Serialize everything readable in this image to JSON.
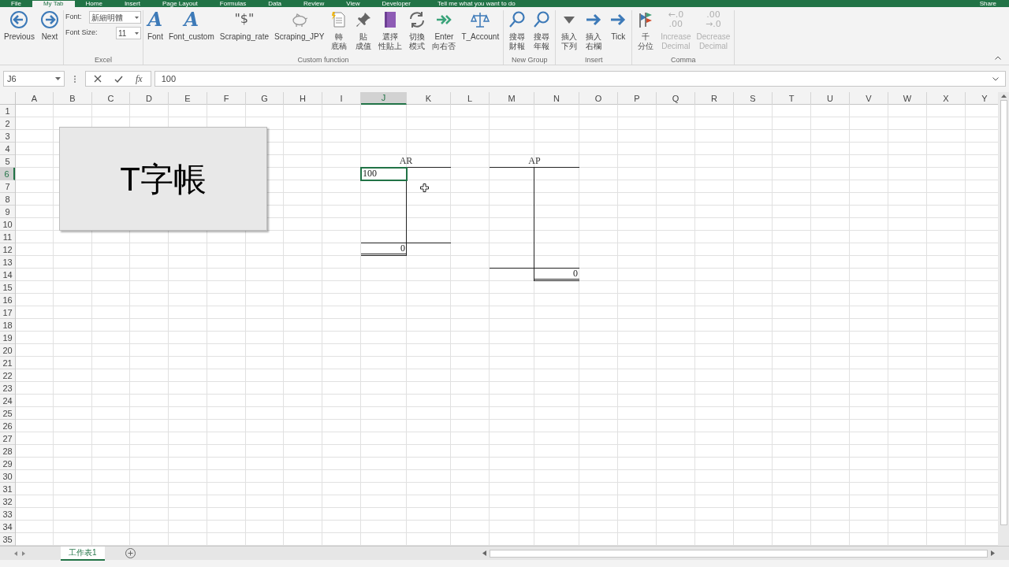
{
  "menu_tabs": [
    {
      "label": "File",
      "selected": false
    },
    {
      "label": "My Tab",
      "selected": true
    },
    {
      "label": "Home",
      "selected": false
    },
    {
      "label": "Insert",
      "selected": false
    },
    {
      "label": "Page Layout",
      "selected": false
    },
    {
      "label": "Formulas",
      "selected": false
    },
    {
      "label": "Data",
      "selected": false
    },
    {
      "label": "Review",
      "selected": false
    },
    {
      "label": "View",
      "selected": false
    },
    {
      "label": "Developer",
      "selected": false
    }
  ],
  "tell_me": "Tell me what you want to do",
  "share": "Share",
  "ribbon": {
    "groups": [
      {
        "items": [
          {
            "kind": "prev",
            "label": [
              "Previous"
            ],
            "disabled": false
          },
          {
            "kind": "next",
            "label": [
              "Next"
            ],
            "disabled": false
          }
        ]
      },
      {
        "label": "Excel",
        "fields": [
          {
            "label": "Font:",
            "value": "新細明體"
          },
          {
            "label": "Font Size:",
            "value": "11"
          }
        ]
      },
      {
        "label": "Custom function",
        "items": [
          {
            "kind": "letter",
            "icon_text": "A",
            "label": [
              "Font"
            ],
            "disabled": false
          },
          {
            "kind": "letter",
            "icon_text": "A",
            "label": [
              "Font_custom"
            ],
            "disabled": false
          },
          {
            "kind": "glyph",
            "icon_text": "\"$\"",
            "label": [
              "Scraping_rate"
            ],
            "disabled": false
          },
          {
            "kind": "piggy",
            "label": [
              "Scraping_JPY"
            ],
            "disabled": false
          },
          {
            "kind": "document",
            "label": [
              "轉",
              "底稿"
            ],
            "disabled": false
          },
          {
            "kind": "pin",
            "label": [
              "貼",
              "成值"
            ],
            "disabled": false
          },
          {
            "kind": "book",
            "label": [
              "選擇",
              "性貼上"
            ],
            "disabled": false
          },
          {
            "kind": "refresh",
            "label": [
              "切換",
              "模式"
            ],
            "disabled": false
          },
          {
            "kind": "double-arrow",
            "label": [
              "Enter",
              "向右否"
            ],
            "disabled": false
          },
          {
            "kind": "scale",
            "label": [
              "T_Account"
            ],
            "disabled": false
          }
        ]
      },
      {
        "label": "New Group",
        "items": [
          {
            "kind": "search",
            "label": [
              "搜尋",
              "財報"
            ],
            "disabled": false
          },
          {
            "kind": "search",
            "label": [
              "搜尋",
              "年報"
            ],
            "disabled": false
          }
        ]
      },
      {
        "label": "Insert",
        "items": [
          {
            "kind": "triangle",
            "label": [
              "插入",
              "下列"
            ],
            "disabled": false
          },
          {
            "kind": "arrow",
            "label": [
              "插入",
              "右欄"
            ],
            "disabled": false
          },
          {
            "kind": "arrow",
            "label": [
              "Tick"
            ],
            "disabled": false
          }
        ]
      },
      {
        "label": "Comma",
        "items": [
          {
            "kind": "flags",
            "label": [
              "千",
              "分位"
            ],
            "disabled": false
          },
          {
            "kind": "glyph",
            "icon_text": "←.0\n.00",
            "label": [
              "Increase",
              "Decimal"
            ],
            "disabled": true
          },
          {
            "kind": "glyph",
            "icon_text": ".00\n→.0",
            "label": [
              "Decrease",
              "Decimal"
            ],
            "disabled": true
          }
        ]
      }
    ]
  },
  "formula_bar": {
    "name_box": "J6",
    "fx": "fx",
    "formula": "100"
  },
  "columns": [
    {
      "label": "A",
      "selected": false
    },
    {
      "label": "B",
      "selected": false
    },
    {
      "label": "C",
      "selected": false
    },
    {
      "label": "D",
      "selected": false
    },
    {
      "label": "E",
      "selected": false
    },
    {
      "label": "F",
      "selected": false
    },
    {
      "label": "G",
      "selected": false
    },
    {
      "label": "H",
      "selected": false
    },
    {
      "label": "I",
      "selected": false
    },
    {
      "label": "J",
      "selected": true
    },
    {
      "label": "K",
      "selected": false
    },
    {
      "label": "L",
      "selected": false
    },
    {
      "label": "M",
      "selected": false
    },
    {
      "label": "N",
      "selected": false
    },
    {
      "label": "O",
      "selected": false
    },
    {
      "label": "P",
      "selected": false
    },
    {
      "label": "Q",
      "selected": false
    },
    {
      "label": "R",
      "selected": false
    },
    {
      "label": "S",
      "selected": false
    },
    {
      "label": "T",
      "selected": false
    },
    {
      "label": "U",
      "selected": false
    },
    {
      "label": "V",
      "selected": false
    },
    {
      "label": "W",
      "selected": false
    },
    {
      "label": "X",
      "selected": false
    },
    {
      "label": "Y",
      "selected": false
    }
  ],
  "rows": [
    {
      "label": "1",
      "selected": false
    },
    {
      "label": "2",
      "selected": false
    },
    {
      "label": "3",
      "selected": false
    },
    {
      "label": "4",
      "selected": false
    },
    {
      "label": "5",
      "selected": false
    },
    {
      "label": "6",
      "selected": true
    },
    {
      "label": "7",
      "selected": false
    },
    {
      "label": "8",
      "selected": false
    },
    {
      "label": "9",
      "selected": false
    },
    {
      "label": "10",
      "selected": false
    },
    {
      "label": "11",
      "selected": false
    },
    {
      "label": "12",
      "selected": false
    },
    {
      "label": "13",
      "selected": false
    },
    {
      "label": "14",
      "selected": false
    },
    {
      "label": "15",
      "selected": false
    },
    {
      "label": "16",
      "selected": false
    },
    {
      "label": "17",
      "selected": false
    },
    {
      "label": "18",
      "selected": false
    },
    {
      "label": "19",
      "selected": false
    },
    {
      "label": "20",
      "selected": false
    },
    {
      "label": "21",
      "selected": false
    },
    {
      "label": "22",
      "selected": false
    },
    {
      "label": "23",
      "selected": false
    },
    {
      "label": "24",
      "selected": false
    },
    {
      "label": "25",
      "selected": false
    },
    {
      "label": "26",
      "selected": false
    },
    {
      "label": "27",
      "selected": false
    },
    {
      "label": "28",
      "selected": false
    },
    {
      "label": "29",
      "selected": false
    },
    {
      "label": "30",
      "selected": false
    },
    {
      "label": "31",
      "selected": false
    },
    {
      "label": "32",
      "selected": false
    },
    {
      "label": "33",
      "selected": false
    },
    {
      "label": "34",
      "selected": false
    },
    {
      "label": "35",
      "selected": false
    }
  ],
  "t_accounts": [
    {
      "title": "AR",
      "entries": [
        {
          "text": "100",
          "selected": true
        }
      ],
      "kind": "debit",
      "balance": "0"
    },
    {
      "title": "AP",
      "kind": "credit",
      "balance": "0"
    }
  ],
  "text_box": "T字帳",
  "sheet_tabs": [
    {
      "label": "工作表1",
      "selected": true
    }
  ]
}
